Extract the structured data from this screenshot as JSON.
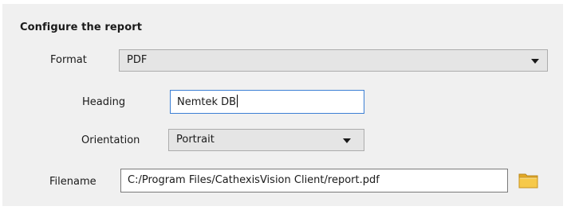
{
  "section": {
    "title": "Configure the report"
  },
  "format": {
    "label": "Format",
    "value": "PDF"
  },
  "heading": {
    "label": "Heading",
    "value": "Nemtek DB"
  },
  "orientation": {
    "label": "Orientation",
    "value": "Portrait"
  },
  "filename": {
    "label": "Filename",
    "value": "C:/Program Files/CathexisVision Client/report.pdf"
  },
  "icons": {
    "browse": "folder-icon",
    "dropdown": "chevron-down-icon"
  },
  "colors": {
    "focus_border": "#3c7fd4",
    "folder": "#f6c94a"
  }
}
